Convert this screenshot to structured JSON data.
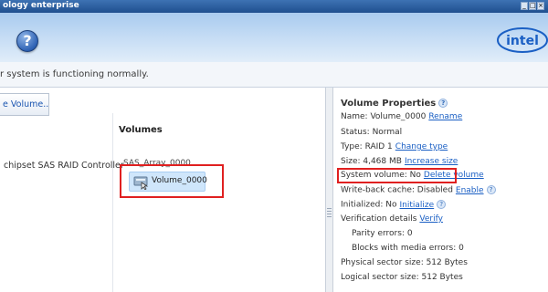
{
  "window": {
    "title": "ology enterprise",
    "controls": [
      "_",
      "□",
      "×"
    ]
  },
  "banner": {
    "help_glyph": "?",
    "logo_text": "intel",
    "colors": {
      "banner_top": "#a9cbef",
      "banner_bottom": "#e1edf9",
      "intel_blue": "#1a5fc4"
    }
  },
  "status": {
    "text": "r system is functioning normally."
  },
  "toolbar": {
    "create_volume_label": "e Volume..."
  },
  "main": {
    "volumes_header": "Volumes",
    "controller": "chipset SAS RAID Controller",
    "array": "SAS_Array_0000",
    "volume": "Volume_0000",
    "icons": {
      "volume": "volume-disk-icon",
      "cursor": "hand-cursor-icon"
    }
  },
  "properties": {
    "title": "Volume Properties",
    "name_label": "Name: Volume_0000",
    "rename_link": "Rename",
    "status": "Status: Normal",
    "type_label": "Type: RAID 1",
    "change_type_link": "Change type",
    "size_label": "Size: 4,468 MB",
    "increase_size_link": "Increase size",
    "system_volume_label": "System volume: No",
    "delete_volume_link": "Delete volume",
    "write_back_label": "Write-back cache: Disabled",
    "enable_link": "Enable",
    "initialized_label": "Initialized: No",
    "initialize_link": "Initialize",
    "verification_label": "Verification details",
    "verify_link": "Verify",
    "parity_errors": "Parity errors: 0",
    "blocks_media_errors": "Blocks with media errors: 0",
    "physical_sector": "Physical sector size: 512 Bytes",
    "logical_sector": "Logical sector size: 512 Bytes",
    "highlight_color": "#e02020"
  }
}
